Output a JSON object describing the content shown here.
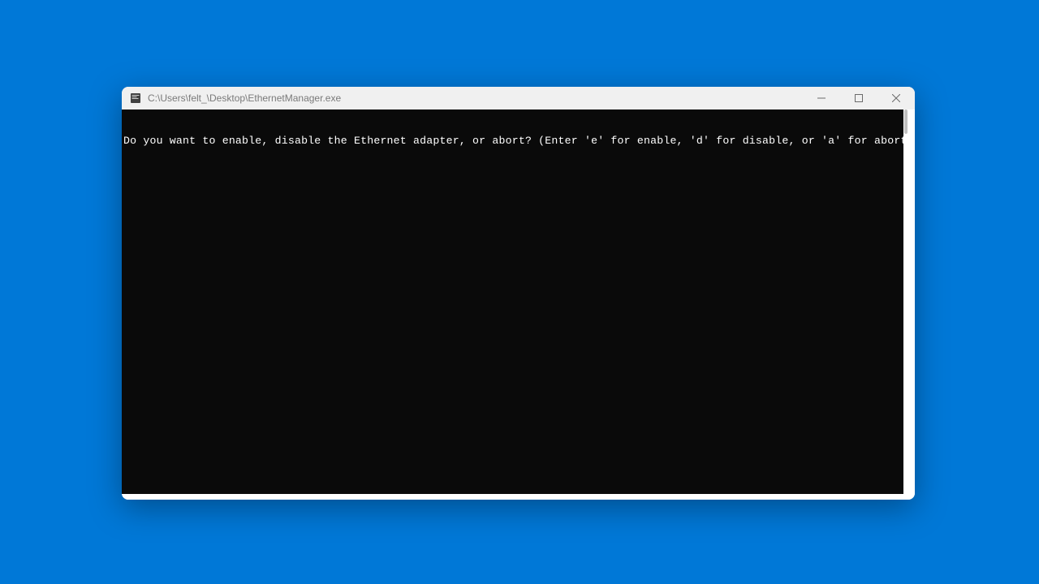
{
  "window": {
    "title": "C:\\Users\\felt_\\Desktop\\EthernetManager.exe"
  },
  "console": {
    "prompt": "Do you want to enable, disable the Ethernet adapter, or abort? (Enter 'e' for enable, 'd' for disable, or 'a' for abort)"
  }
}
